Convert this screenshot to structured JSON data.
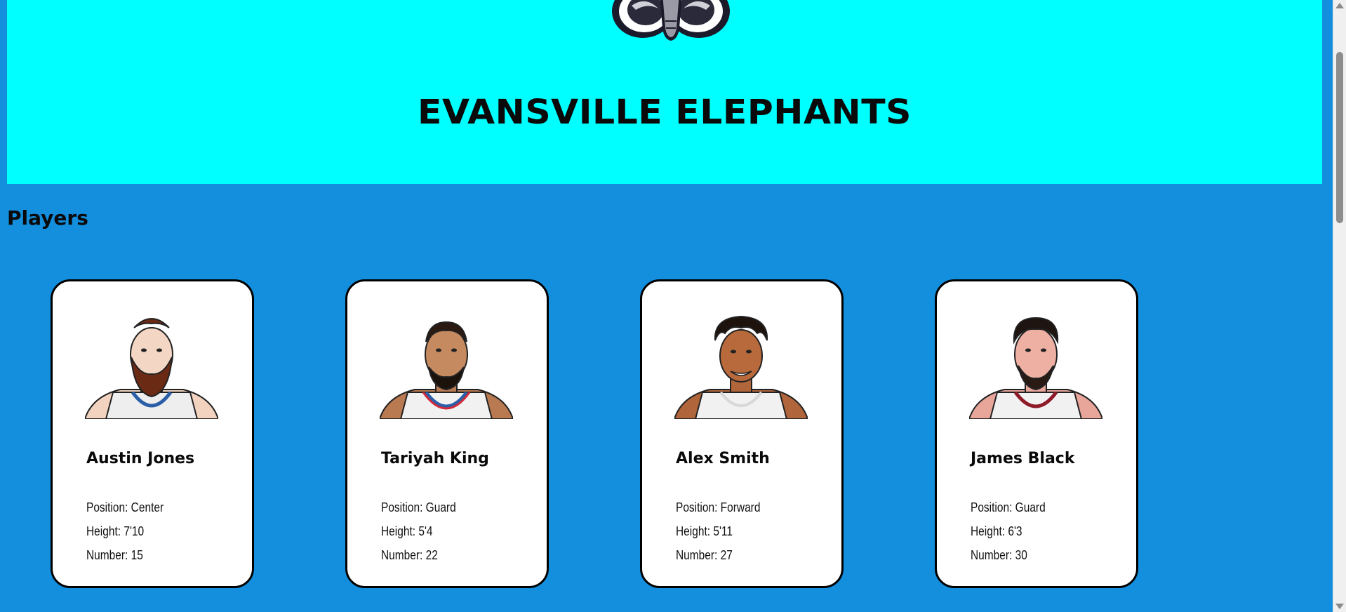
{
  "header": {
    "title": "EVANSVILLE ELEPHANTS",
    "logo_icon": "elephant-logo-icon",
    "background": "#00ffff"
  },
  "section": {
    "title": "Players"
  },
  "colors": {
    "page_background": "#138fde",
    "card_background": "#ffffff",
    "card_border": "#000000"
  },
  "players": [
    {
      "name": "Austin Jones",
      "position": "Position: Center",
      "height": "Height: 7'10",
      "number": "Number: 15",
      "avatar_icon": "player-avatar-icon"
    },
    {
      "name": "Tariyah King",
      "position": "Position: Guard",
      "height": "Height: 5'4",
      "number": "Number: 22",
      "avatar_icon": "player-avatar-icon"
    },
    {
      "name": "Alex Smith",
      "position": "Position: Forward",
      "height": "Height: 5'11",
      "number": "Number: 27",
      "avatar_icon": "player-avatar-icon"
    },
    {
      "name": "James Black",
      "position": "Position: Guard",
      "height": "Height: 6'3",
      "number": "Number: 30",
      "avatar_icon": "player-avatar-icon"
    }
  ]
}
